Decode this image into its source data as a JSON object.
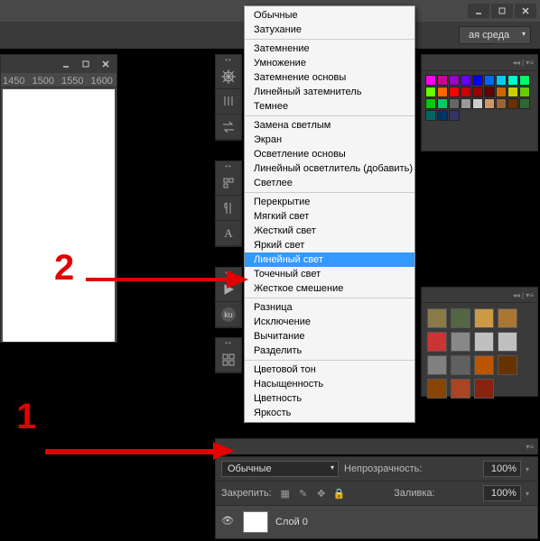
{
  "topbar": {},
  "workspace": {
    "label": "ая среда"
  },
  "doc": {
    "ruler_marks": [
      "1450",
      "1500",
      "1550",
      "1600"
    ]
  },
  "blend_menu": {
    "groups": [
      {
        "items": [
          "Обычные",
          "Затухание"
        ]
      },
      {
        "items": [
          "Затемнение",
          "Умножение",
          "Затемнение основы",
          "Линейный затемнитель",
          "Темнее"
        ]
      },
      {
        "items": [
          "Замена светлым",
          "Экран",
          "Осветление основы",
          "Линейный осветлитель (добавить)",
          "Светлее"
        ]
      },
      {
        "items": [
          "Перекрытие",
          "Мягкий свет",
          "Жесткий свет",
          "Яркий свет",
          "Линейный свет",
          "Точечный свет",
          "Жесткое смешение"
        ]
      },
      {
        "items": [
          "Разница",
          "Исключение",
          "Вычитание",
          "Разделить"
        ]
      },
      {
        "items": [
          "Цветовой тон",
          "Насыщенность",
          "Цветность",
          "Яркость"
        ]
      }
    ],
    "selected": "Линейный свет"
  },
  "layers": {
    "blend_current": "Обычные",
    "opacity_label": "Непрозрачность:",
    "opacity_value": "100%",
    "lock_label": "Закрепить:",
    "fill_label": "Заливка:",
    "fill_value": "100%",
    "layer0": {
      "name": "Слой 0"
    }
  },
  "annotations": {
    "one": "1",
    "two": "2"
  },
  "swatches": [
    "#ff00ff",
    "#cc0099",
    "#9900cc",
    "#6600ff",
    "#0000ff",
    "#0066ff",
    "#00ccff",
    "#00ffcc",
    "#00ff66",
    "#66ff00",
    "#ff6600",
    "#ff0000",
    "#cc0000",
    "#990000",
    "#660000",
    "#cc6600",
    "#cccc00",
    "#66cc00",
    "#00cc00",
    "#00cc66",
    "#666666",
    "#999999",
    "#cccccc",
    "#cc9966",
    "#996633",
    "#663300",
    "#336633",
    "#006666",
    "#003366",
    "#333366"
  ],
  "styles": [
    "#8a7a4a",
    "#556644",
    "#cc9944",
    "#aa7733",
    "#cc3333",
    "#888888",
    "#c0c0c0",
    "#c0c0c0",
    "#808080",
    "#606060",
    "#bb5500",
    "#663300",
    "#884400",
    "#aa4422",
    "#882211"
  ]
}
